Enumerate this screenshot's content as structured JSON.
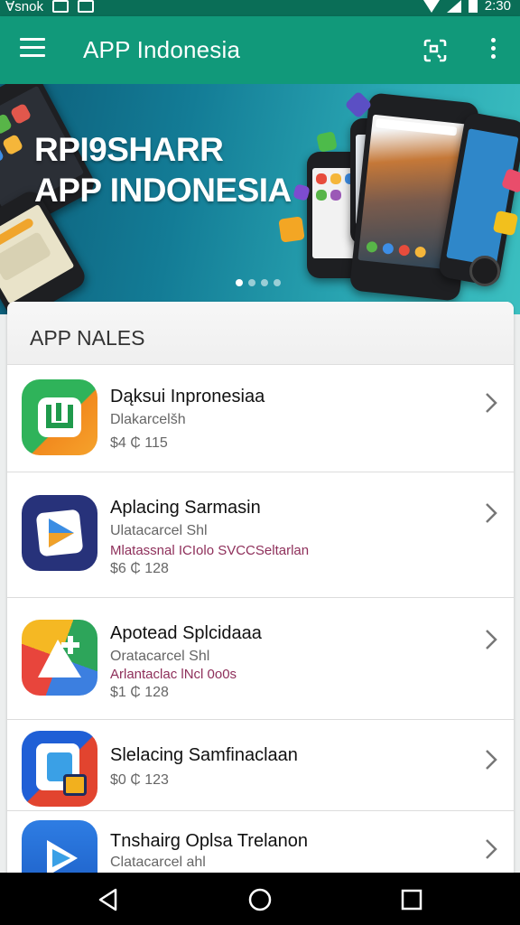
{
  "status_bar": {
    "carrier": "Ɐsnok",
    "time": "2:30"
  },
  "app_bar": {
    "title": "APP Indonesia"
  },
  "banner": {
    "line1": "RPI9SHARR",
    "line2": "APP INDONESIA",
    "page_count": 4,
    "active_page": 1
  },
  "section": {
    "title": "APP NALES"
  },
  "apps": [
    {
      "title": "Dąksui Inpronesiaa",
      "subtitle": "Dlakarcelšh",
      "tag": "",
      "price": "$4 ₵ 115"
    },
    {
      "title": "Aplacing Sarmasin",
      "subtitle": "Ulatacarcel Shl",
      "tag": "Mlatassnal ICIolo SVCCSeltarlan",
      "price": "$6 ₵ 128"
    },
    {
      "title": "Apotead Splcidaaa",
      "subtitle": "Oratacarcel Shl",
      "tag": "Arlantaclac lNcl 0o0s",
      "price": "$1 ₵ 128"
    },
    {
      "title": "Slelacing Samfinaclaan",
      "subtitle": "",
      "tag": "",
      "price": "$0 ₵ 123"
    },
    {
      "title": "Tnshairg Oplsa Trelanon",
      "subtitle": "Clatacarcel ahl",
      "tag": "",
      "price": ""
    }
  ],
  "colors": {
    "app_bar": "#11997a",
    "status_bar": "#0a6e57",
    "accent_tag": "#8e2f5a"
  },
  "icons": {
    "app_1": "green-bracket-app-icon",
    "app_2": "blue-play-app-icon",
    "app_3": "colorful-plus-app-icon",
    "app_4": "blue-lock-app-icon",
    "app_5": "blue-play-app-icon"
  }
}
